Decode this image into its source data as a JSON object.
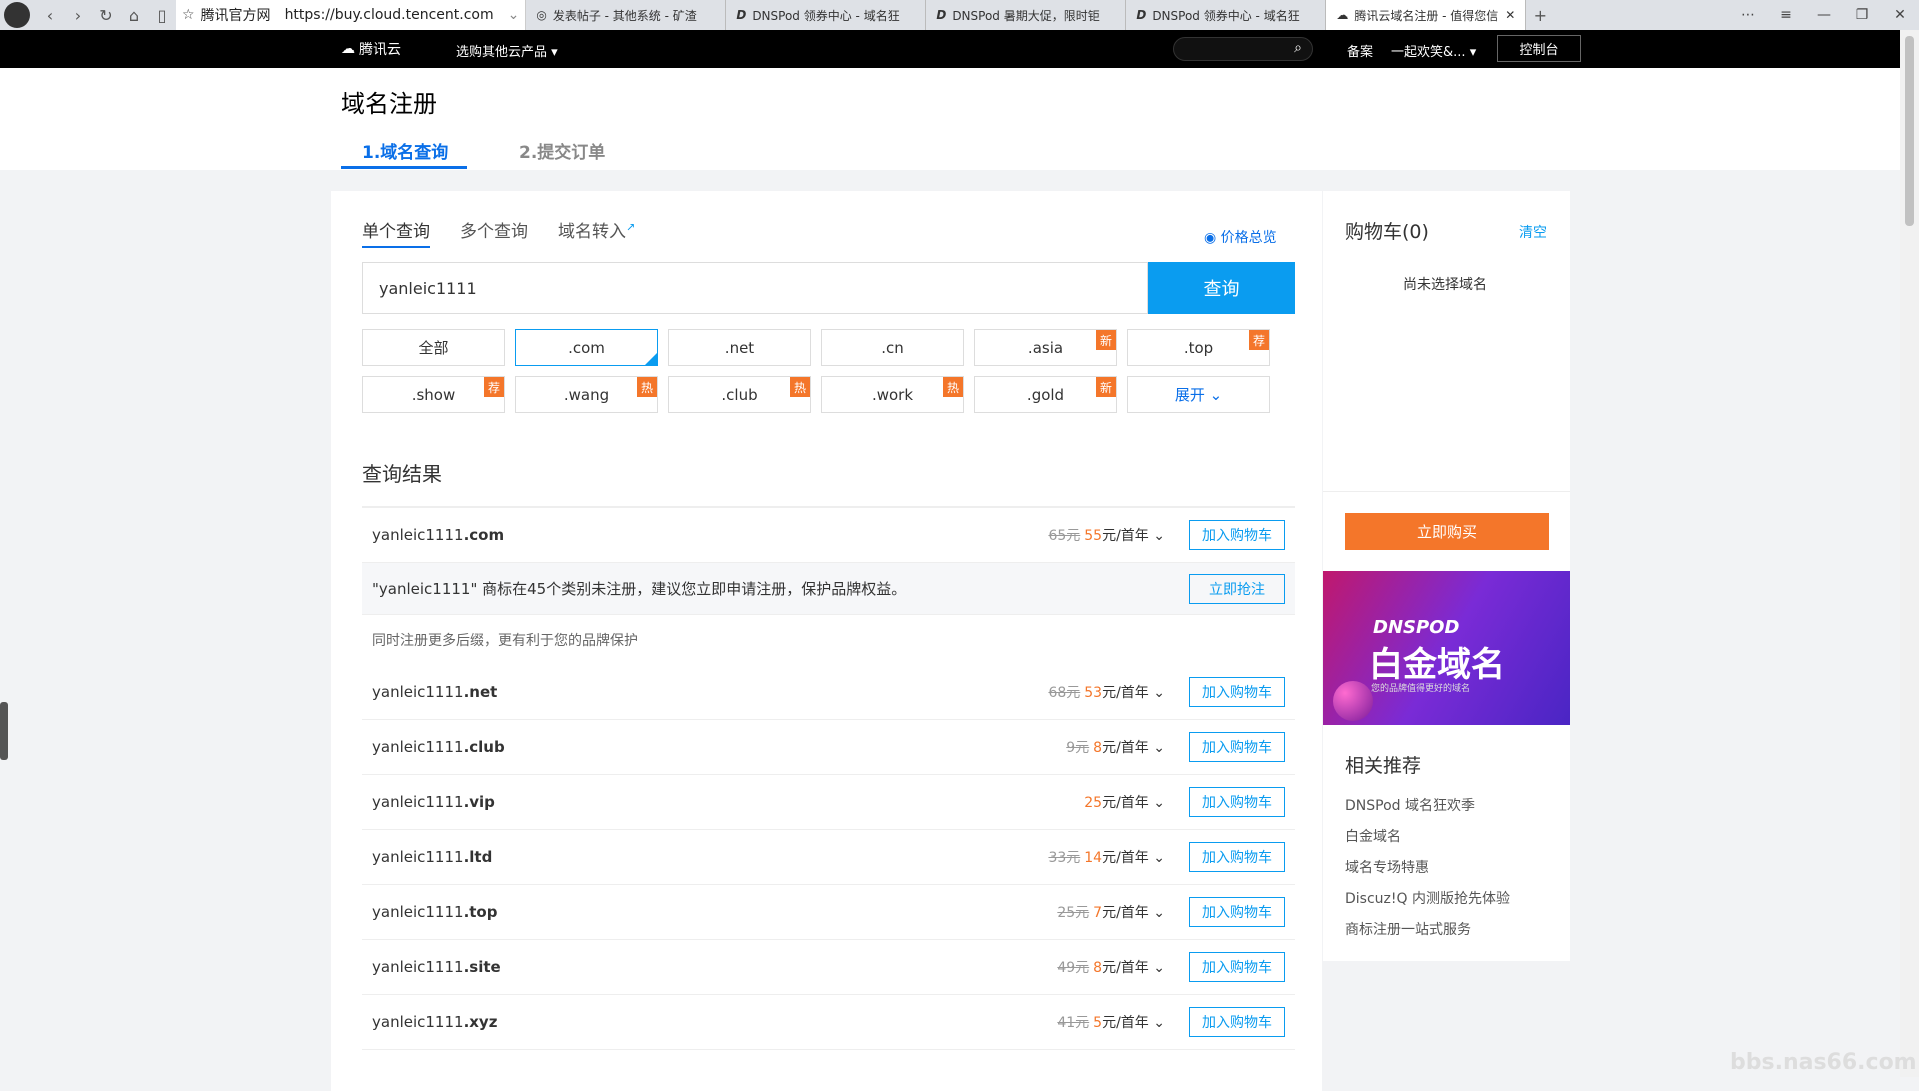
{
  "browser": {
    "address_site": "腾讯官方网",
    "address_url": "https://buy.cloud.tencent.com",
    "tabs": [
      {
        "label": "发表帖子 - 其他系统 - 矿渣"
      },
      {
        "label": "DNSPod 领券中心 - 域名狂"
      },
      {
        "label": "DNSPod 暑期大促，限时钜"
      },
      {
        "label": "DNSPod 领券中心 - 域名狂"
      },
      {
        "label": "腾讯云域名注册 - 值得您信"
      }
    ]
  },
  "site_nav": {
    "logo_text": "腾讯云",
    "products": "选购其他云产品",
    "link_beian": "备案",
    "user": "一起欢笑&...",
    "console": "控制台"
  },
  "header": {
    "title": "域名注册",
    "step1": "1.域名查询",
    "step2": "2.提交订单"
  },
  "query": {
    "tab_single": "单个查询",
    "tab_multi": "多个查询",
    "tab_transfer": "域名转入",
    "price_overview": "价格总览",
    "input_value": "yanleic1111",
    "search_button": "查询"
  },
  "suffixes": [
    {
      "label": "全部",
      "badge": ""
    },
    {
      "label": ".com",
      "badge": ""
    },
    {
      "label": ".net",
      "badge": ""
    },
    {
      "label": ".cn",
      "badge": ""
    },
    {
      "label": ".asia",
      "badge": "新"
    },
    {
      "label": ".top",
      "badge": "荐"
    },
    {
      "label": ".show",
      "badge": "荐"
    },
    {
      "label": ".wang",
      "badge": "热"
    },
    {
      "label": ".club",
      "badge": "热"
    },
    {
      "label": ".work",
      "badge": "热"
    },
    {
      "label": ".gold",
      "badge": "新"
    },
    {
      "label": "展开",
      "badge": ""
    }
  ],
  "results": {
    "title": "查询结果",
    "main": {
      "prefix": "yanleic1111",
      "suffix": ".com",
      "old": "65元",
      "now": "55",
      "unit": "元/首年",
      "button": "加入购物车"
    },
    "trademark_text": "\"yanleic1111\" 商标在45个类别未注册，建议您立即申请注册，保护品牌权益。",
    "trademark_button": "立即抢注",
    "hint": "同时注册更多后缀，更有利于您的品牌保护",
    "rows": [
      {
        "prefix": "yanleic1111",
        "suffix": ".net",
        "old": "68元",
        "now": "53",
        "unit": "元/首年",
        "button": "加入购物车"
      },
      {
        "prefix": "yanleic1111",
        "suffix": ".club",
        "old": "9元",
        "now": "8",
        "unit": "元/首年",
        "button": "加入购物车"
      },
      {
        "prefix": "yanleic1111",
        "suffix": ".vip",
        "old": "",
        "now": "25",
        "unit": "元/首年",
        "button": "加入购物车"
      },
      {
        "prefix": "yanleic1111",
        "suffix": ".ltd",
        "old": "33元",
        "now": "14",
        "unit": "元/首年",
        "button": "加入购物车"
      },
      {
        "prefix": "yanleic1111",
        "suffix": ".top",
        "old": "25元",
        "now": "7",
        "unit": "元/首年",
        "button": "加入购物车"
      },
      {
        "prefix": "yanleic1111",
        "suffix": ".site",
        "old": "49元",
        "now": "8",
        "unit": "元/首年",
        "button": "加入购物车"
      },
      {
        "prefix": "yanleic1111",
        "suffix": ".xyz",
        "old": "41元",
        "now": "5",
        "unit": "元/首年",
        "button": "加入购物车"
      }
    ]
  },
  "cart": {
    "title": "购物车(0)",
    "clear": "清空",
    "empty": "尚未选择域名",
    "buy": "立即购买"
  },
  "banner": {
    "brand": "DNSPOD",
    "headline": "白金域名",
    "tagline": "您的品牌值得更好的域名"
  },
  "recommend": {
    "title": "相关推荐",
    "items": [
      "DNSPod 域名狂欢季",
      "白金域名",
      "域名专场特惠",
      "Discuz!Q 内测版抢先体验",
      "商标注册一站式服务"
    ]
  },
  "watermark": "bbs.nas66.com"
}
